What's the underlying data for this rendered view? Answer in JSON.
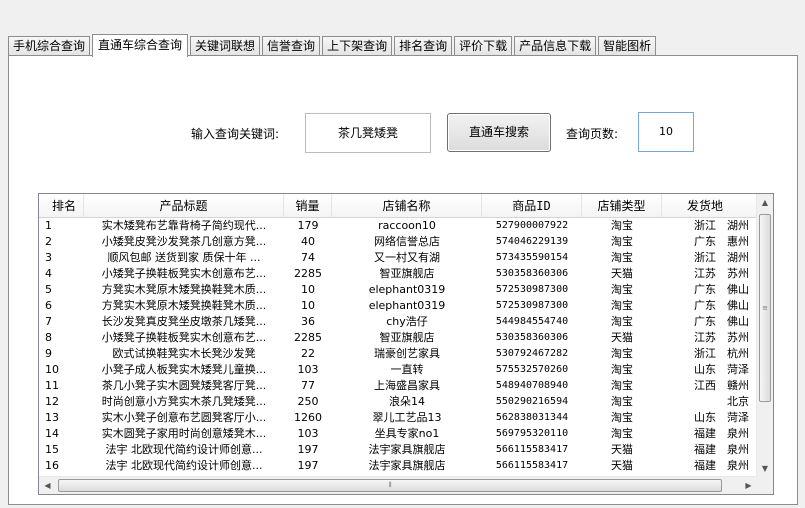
{
  "tabs": [
    {
      "label": "手机综合查询",
      "active": false
    },
    {
      "label": "直通车综合查询",
      "active": true
    },
    {
      "label": "关键词联想",
      "active": false
    },
    {
      "label": "信誉查询",
      "active": false
    },
    {
      "label": "上下架查询",
      "active": false
    },
    {
      "label": "排名查询",
      "active": false
    },
    {
      "label": "评价下载",
      "active": false
    },
    {
      "label": "产品信息下载",
      "active": false
    },
    {
      "label": "智能图析",
      "active": false
    }
  ],
  "search": {
    "keyword_label": "输入查询关键词:",
    "keyword_value": "茶几凳矮凳",
    "search_button": "直通车搜索",
    "pages_label": "查询页数:",
    "pages_value": "10"
  },
  "grid": {
    "columns": [
      "排名",
      "产品标题",
      "销量",
      "店铺名称",
      "商品ID",
      "店铺类型",
      "发货地"
    ],
    "rows": [
      [
        "1",
        "实木矮凳布艺靠背椅子简约现代...",
        "179",
        "raccoon10",
        "527900007922",
        "淘宝",
        "浙江　湖州"
      ],
      [
        "2",
        "小矮凳皮凳沙发凳茶几创意方凳...",
        "40",
        "网络信誉总店",
        "574046229139",
        "淘宝",
        "广东　惠州"
      ],
      [
        "3",
        "顺风包邮 送货到家 质保十年 ...",
        "74",
        "又一村又有湖",
        "573435590154",
        "淘宝",
        "浙江　湖州"
      ],
      [
        "4",
        "小矮凳子换鞋板凳实木创意布艺...",
        "2285",
        "智亚旗舰店",
        "530358360306",
        "天猫",
        "江苏　苏州"
      ],
      [
        "5",
        "方凳实木凳原木矮凳换鞋凳木质...",
        "10",
        "elephant0319",
        "572530987300",
        "淘宝",
        "广东　佛山"
      ],
      [
        "6",
        "方凳实木凳原木矮凳换鞋凳木质...",
        "10",
        "elephant0319",
        "572530987300",
        "淘宝",
        "广东　佛山"
      ],
      [
        "7",
        "长沙发凳真皮凳坐皮墩茶几矮凳...",
        "36",
        "chy浩仔",
        "544984554740",
        "淘宝",
        "广东　佛山"
      ],
      [
        "8",
        "小矮凳子换鞋板凳实木创意布艺...",
        "2285",
        "智亚旗舰店",
        "530358360306",
        "天猫",
        "江苏　苏州"
      ],
      [
        "9",
        "欧式试换鞋凳实木长凳沙发凳",
        "22",
        "瑞豪创艺家具",
        "530792467282",
        "淘宝",
        "浙江　杭州"
      ],
      [
        "10",
        "小凳子成人板凳实木矮凳儿童换...",
        "103",
        "一直转",
        "575532570260",
        "淘宝",
        "山东　菏泽"
      ],
      [
        "11",
        "茶几小凳子实木圆凳矮凳客厅凳...",
        "77",
        "上海盛昌家具",
        "548940708940",
        "淘宝",
        "江西　赣州"
      ],
      [
        "12",
        "时尚创意小方凳实木茶几凳矮凳...",
        "250",
        "浪朵14",
        "550290216594",
        "淘宝",
        "北京"
      ],
      [
        "13",
        "实木小凳子创意布艺圆凳客厅小...",
        "1260",
        "翠儿工艺品13",
        "562838031344",
        "淘宝",
        "山东　菏泽"
      ],
      [
        "14",
        "实木圆凳子家用时尚创意矮凳木...",
        "103",
        "坐具专家no1",
        "569795320110",
        "淘宝",
        "福建　泉州"
      ],
      [
        "15",
        "法宇 北欧现代简约设计师创意...",
        "197",
        "法宇家具旗舰店",
        "566115583417",
        "天猫",
        "福建　泉州"
      ],
      [
        "16",
        "法宇 北欧现代简约设计师创意...",
        "197",
        "法宇家具旗舰店",
        "566115583417",
        "天猫",
        "福建　泉州"
      ]
    ]
  },
  "scrollbar": {
    "up_icon": "▲",
    "down_icon": "▼",
    "left_icon": "◀",
    "right_icon": "▶",
    "v_grip": "≡",
    "h_grip": "⦀"
  }
}
